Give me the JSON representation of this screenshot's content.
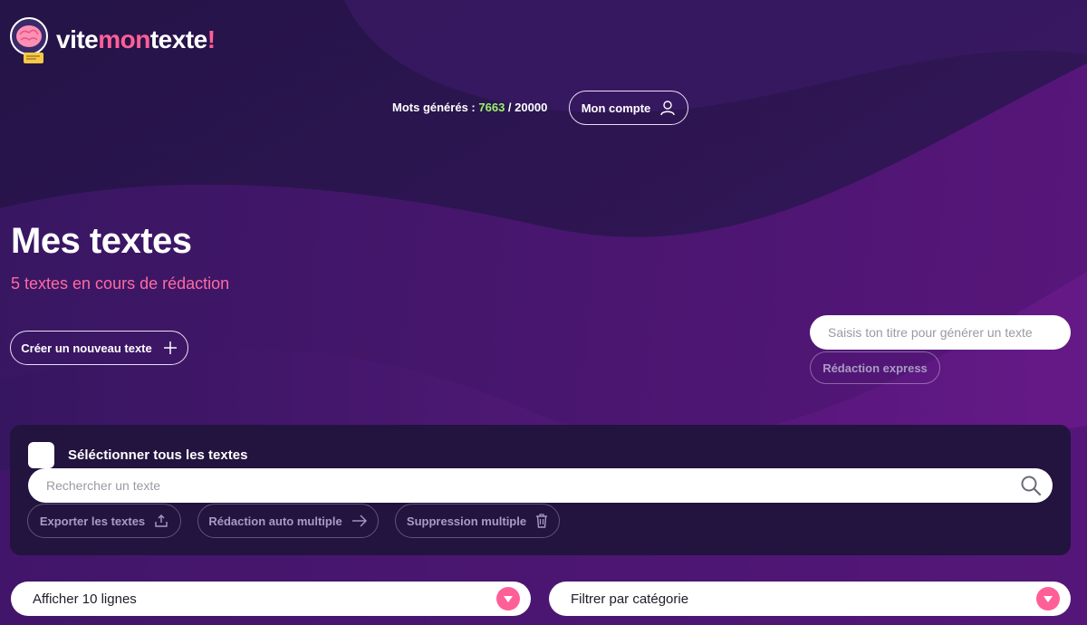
{
  "brand": {
    "logo_parts": [
      "vite",
      "mon",
      "texte",
      "!"
    ],
    "accent": "#ff5f97"
  },
  "header": {
    "words_label": "Mots générés :",
    "words_used": "7663",
    "words_total": "/ 20000",
    "account_label": "Mon compte",
    "account_icon": "user-icon"
  },
  "main": {
    "title": "Mes textes",
    "subtitle": "5 textes en cours de rédaction",
    "new_text_label": "Créer un nouveau texte",
    "express_placeholder": "Saisis ton titre pour générer un texte",
    "express_button": "Rédaction express"
  },
  "panel": {
    "select_all_label": "Séléctionner tous les textes",
    "search_placeholder": "Rechercher un texte",
    "actions": [
      {
        "label": "Exporter les textes",
        "icon": "upload-icon"
      },
      {
        "label": "Rédaction auto multiple",
        "icon": "arrow-right-icon"
      },
      {
        "label": "Suppression multiple",
        "icon": "trash-icon"
      }
    ]
  },
  "filters": {
    "lines_select": "Afficher 10 lignes",
    "category_select": "Filtrer par catégorie"
  },
  "colors": {
    "bg_dark": "#2a1550",
    "bg_purple": "#5a1478",
    "panel": "#22133f",
    "green": "#9bf26a",
    "pink": "#ff6aa0"
  }
}
